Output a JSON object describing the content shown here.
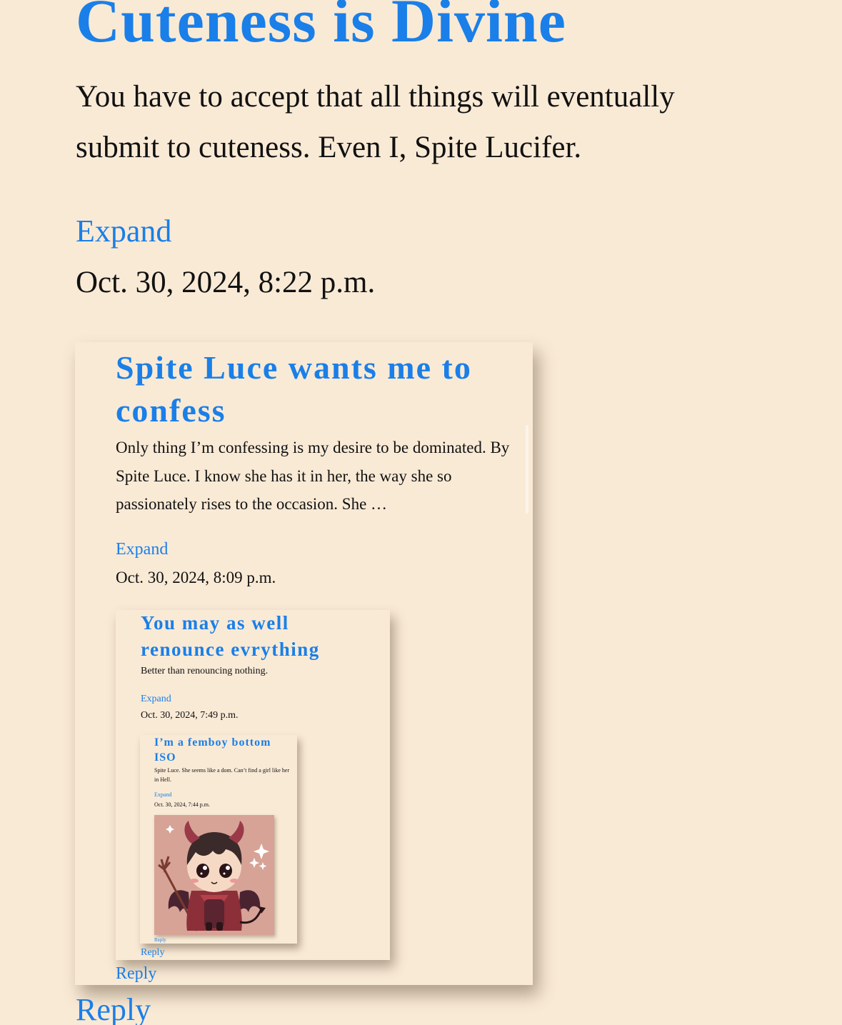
{
  "post": {
    "title": "Cuteness is Divine",
    "body": "You have to accept that all things will eventually submit to cuteness. Even I, Spite Lucifer.",
    "expand_label": "Expand",
    "date": "Oct. 30, 2024, 8:22 p.m.",
    "reply_label": "Reply"
  },
  "reply1": {
    "title": "Spite Luce wants me to confess",
    "body": "Only thing I’m confessing is my desire to be dominated. By Spite Luce. I know she has it in her, the way she so passionately rises to the occasion. She …",
    "expand_label": "Expand",
    "date": "Oct. 30, 2024, 8:09 p.m.",
    "reply_label": "Reply"
  },
  "reply2": {
    "title": "You may as well renounce evrything",
    "body": "Better than renouncing nothing.",
    "expand_label": "Expand",
    "date": "Oct. 30, 2024, 7:49 p.m.",
    "reply_label": "Reply"
  },
  "reply3": {
    "title": "I’m a femboy bottom ISO",
    "body": "Spite Luce. She seems like a dom. Can’t find a girl like her in Hell.",
    "expand_label": "Expand",
    "date": "Oct. 30, 2024, 7:44 p.m.",
    "reply_label": "Reply",
    "image_icon": "chibi-devil-illustration"
  },
  "colors": {
    "background": "#f9ead6",
    "link": "#1a7fe8",
    "text": "#111111"
  }
}
